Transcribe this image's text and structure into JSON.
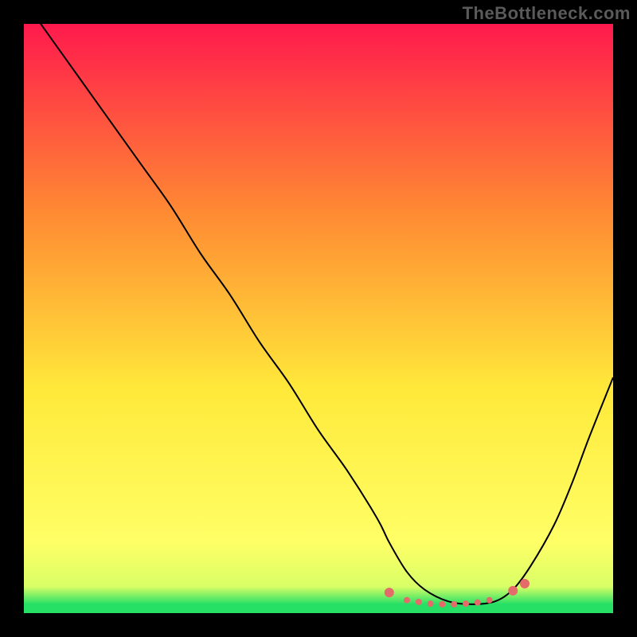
{
  "attribution": "TheBottleneck.com",
  "chart_data": {
    "type": "line",
    "title": "",
    "xlabel": "",
    "ylabel": "",
    "xlim": [
      0,
      100
    ],
    "ylim": [
      0,
      100
    ],
    "gradient_colors": {
      "top": "#ff1a4d",
      "mid_upper": "#ff8a33",
      "mid": "#ffe93a",
      "mid_lower": "#ffff66",
      "bottom": "#26e066"
    },
    "series": [
      {
        "name": "bottleneck-curve",
        "x": [
          0,
          5,
          10,
          15,
          20,
          25,
          30,
          35,
          40,
          45,
          50,
          55,
          60,
          62,
          65,
          68,
          72,
          76,
          80,
          83,
          86,
          90,
          93,
          96,
          100
        ],
        "y": [
          104,
          97,
          90,
          83,
          76,
          69,
          61,
          54,
          46,
          39,
          31,
          24,
          16,
          12,
          7,
          4,
          2,
          1.5,
          2,
          4,
          8,
          15,
          22,
          30,
          40
        ]
      }
    ],
    "markers": {
      "name": "highlight-dots",
      "color": "#e56b6b",
      "radius_small": 4,
      "radius_large": 6,
      "points": [
        {
          "x": 62,
          "y": 3.5,
          "r": "large"
        },
        {
          "x": 65,
          "y": 2.2,
          "r": "small"
        },
        {
          "x": 67,
          "y": 1.9,
          "r": "small"
        },
        {
          "x": 69,
          "y": 1.6,
          "r": "small"
        },
        {
          "x": 71,
          "y": 1.5,
          "r": "small"
        },
        {
          "x": 73,
          "y": 1.5,
          "r": "small"
        },
        {
          "x": 75,
          "y": 1.6,
          "r": "small"
        },
        {
          "x": 77,
          "y": 1.8,
          "r": "small"
        },
        {
          "x": 79,
          "y": 2.2,
          "r": "small"
        },
        {
          "x": 83,
          "y": 3.8,
          "r": "large"
        },
        {
          "x": 85,
          "y": 5.0,
          "r": "large"
        }
      ]
    }
  }
}
